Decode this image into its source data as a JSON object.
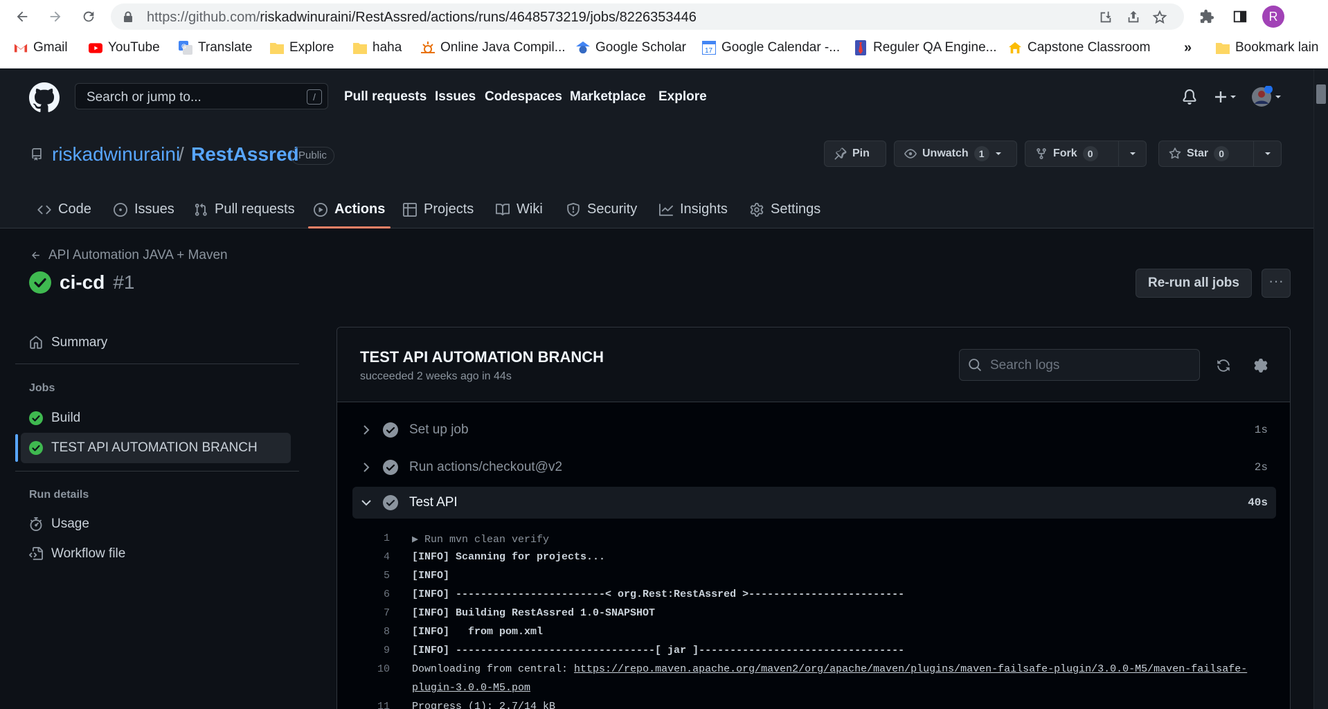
{
  "browser": {
    "url_prefix": "https://github.com/",
    "url_path": "riskadwinuraini/RestAssred/actions/runs/4648573219/jobs/8226353446",
    "profile_initial": "R",
    "bookmarks": [
      {
        "label": "Gmail",
        "icon": "gmail-icon"
      },
      {
        "label": "YouTube",
        "icon": "youtube-icon"
      },
      {
        "label": "Translate",
        "icon": "translate-icon"
      },
      {
        "label": "Explore",
        "icon": "folder-icon"
      },
      {
        "label": "haha",
        "icon": "folder-icon"
      },
      {
        "label": "Online Java Compil...",
        "icon": "compiler-icon"
      },
      {
        "label": "Google Scholar",
        "icon": "scholar-icon"
      },
      {
        "label": "Google Calendar -...",
        "icon": "calendar-icon"
      },
      {
        "label": "Reguler QA Engine...",
        "icon": "tie-icon"
      },
      {
        "label": "Capstone Classroom",
        "icon": "classroom-icon"
      }
    ],
    "bookmarks_overflow": "»",
    "other_bookmarks": "Bookmark lain"
  },
  "github": {
    "search_placeholder": "Search or jump to...",
    "search_shortcut": "/",
    "nav": [
      "Pull requests",
      "Issues",
      "Codespaces",
      "Marketplace",
      "Explore"
    ]
  },
  "repo": {
    "owner": "riskadwinuraini",
    "separator": "/",
    "name": "RestAssred",
    "visibility": "Public",
    "pin_label": "Pin",
    "unwatch_label": "Unwatch",
    "watch_count": "1",
    "fork_label": "Fork",
    "fork_count": "0",
    "star_label": "Star",
    "star_count": "0",
    "tabs": [
      {
        "label": "Code",
        "icon": "code-icon"
      },
      {
        "label": "Issues",
        "icon": "issue-icon"
      },
      {
        "label": "Pull requests",
        "icon": "pull-request-icon"
      },
      {
        "label": "Actions",
        "icon": "play-icon",
        "active": true
      },
      {
        "label": "Projects",
        "icon": "table-icon"
      },
      {
        "label": "Wiki",
        "icon": "book-icon"
      },
      {
        "label": "Security",
        "icon": "shield-icon"
      },
      {
        "label": "Insights",
        "icon": "graph-icon"
      },
      {
        "label": "Settings",
        "icon": "gear-icon"
      }
    ]
  },
  "run": {
    "workflow_name": "API Automation JAVA + Maven",
    "title": "ci-cd",
    "number": "#1",
    "rerun_label": "Re-run all jobs",
    "more_label": "···"
  },
  "sidebar": {
    "summary": "Summary",
    "jobs_heading": "Jobs",
    "jobs": [
      "Build",
      "TEST API AUTOMATION BRANCH"
    ],
    "run_details_heading": "Run details",
    "usage": "Usage",
    "workflow_file": "Workflow file"
  },
  "job": {
    "title": "TEST API AUTOMATION BRANCH",
    "subtitle": "succeeded 2 weeks ago in 44s",
    "search_placeholder": "Search logs",
    "steps": [
      {
        "name": "Set up job",
        "duration": "1s",
        "expanded": false
      },
      {
        "name": "Run actions/checkout@v2",
        "duration": "2s",
        "expanded": false
      },
      {
        "name": "Test API",
        "duration": "40s",
        "expanded": true
      }
    ],
    "log": [
      {
        "n": "1",
        "text": "▶ Run mvn clean verify"
      },
      {
        "n": "4",
        "text": "[INFO] Scanning for projects..."
      },
      {
        "n": "5",
        "text": "[INFO]"
      },
      {
        "n": "6",
        "text": "[INFO] ------------------------< org.Rest:RestAssred >-------------------------"
      },
      {
        "n": "7",
        "text": "[INFO] Building RestAssred 1.0-SNAPSHOT"
      },
      {
        "n": "8",
        "text": "[INFO]   from pom.xml"
      },
      {
        "n": "9",
        "text": "[INFO] --------------------------------[ jar ]---------------------------------"
      },
      {
        "n": "10",
        "text": "Downloading from central: ",
        "link": "https://repo.maven.apache.org/maven2/org/apache/maven/plugins/maven-failsafe-plugin/3.0.0-M5/maven-failsafe-",
        "link_cont": "plugin-3.0.0-M5.pom"
      },
      {
        "n": "11",
        "text": "Progress (1): 2.7/14 kB"
      }
    ]
  },
  "colors": {
    "success": "#3fb950",
    "link": "#58a6ff",
    "active_tab_underline": "#f78166"
  }
}
